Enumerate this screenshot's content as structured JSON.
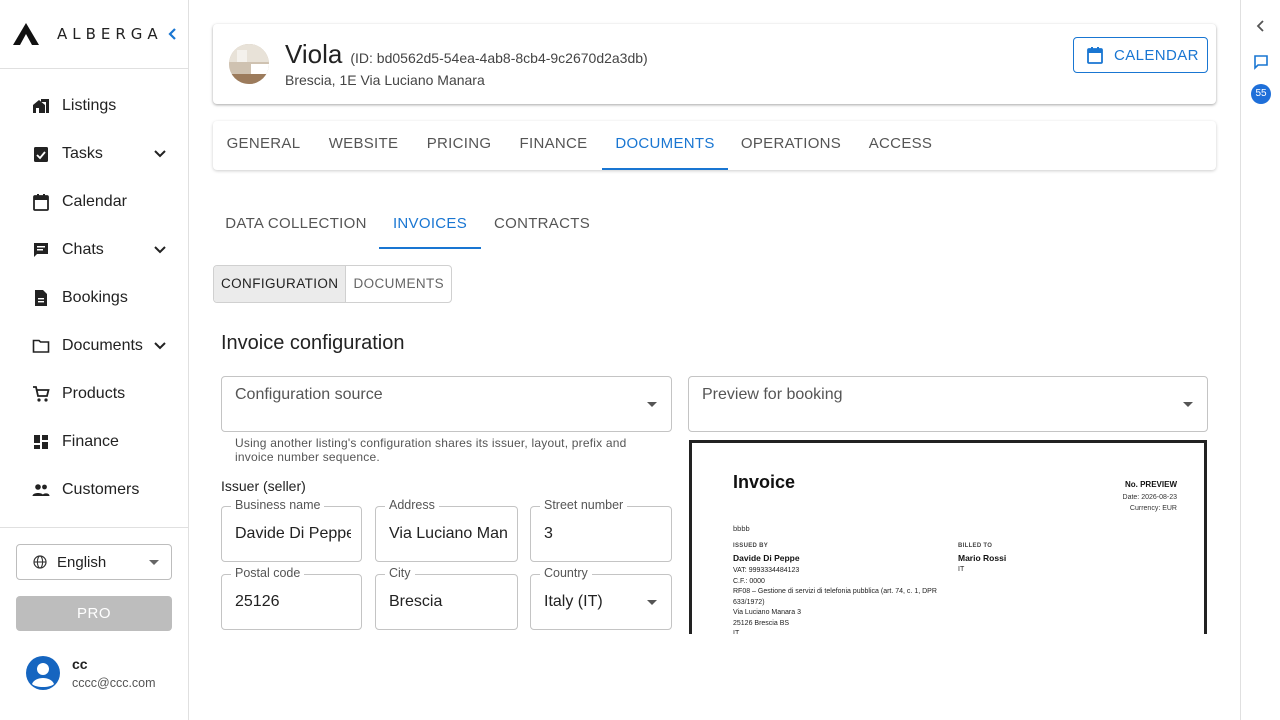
{
  "brand": {
    "name": "ALBERGA"
  },
  "nav": {
    "items": [
      {
        "label": "Listings",
        "icon": "home-work-icon",
        "expandable": false
      },
      {
        "label": "Tasks",
        "icon": "assignment-icon",
        "expandable": true
      },
      {
        "label": "Calendar",
        "icon": "calendar-icon",
        "expandable": false
      },
      {
        "label": "Chats",
        "icon": "chat-icon",
        "expandable": true
      },
      {
        "label": "Bookings",
        "icon": "document-icon",
        "expandable": false
      },
      {
        "label": "Documents",
        "icon": "folder-icon",
        "expandable": true
      },
      {
        "label": "Products",
        "icon": "cart-icon",
        "expandable": false
      },
      {
        "label": "Finance",
        "icon": "dashboard-icon",
        "expandable": false
      },
      {
        "label": "Customers",
        "icon": "people-icon",
        "expandable": false
      }
    ]
  },
  "language": {
    "selected": "English"
  },
  "pro_button": "PRO",
  "user": {
    "name": "cc",
    "email": "cccc@ccc.com"
  },
  "right_rail": {
    "badge_count": "55"
  },
  "listing": {
    "name": "Viola",
    "id_text": "(ID: bd0562d5-54ea-4ab8-8cb4-9c2670d2a3db)",
    "address": "Brescia, 1E Via Luciano Manara"
  },
  "calendar_button": "CALENDAR",
  "tabs": [
    {
      "label": "GENERAL",
      "active": false
    },
    {
      "label": "WEBSITE",
      "active": false
    },
    {
      "label": "PRICING",
      "active": false
    },
    {
      "label": "FINANCE",
      "active": false
    },
    {
      "label": "DOCUMENTS",
      "active": true
    },
    {
      "label": "OPERATIONS",
      "active": false
    },
    {
      "label": "ACCESS",
      "active": false
    }
  ],
  "subtabs": [
    {
      "label": "DATA COLLECTION",
      "active": false
    },
    {
      "label": "INVOICES",
      "active": true
    },
    {
      "label": "CONTRACTS",
      "active": false
    }
  ],
  "toggle": [
    {
      "label": "CONFIGURATION",
      "active": true
    },
    {
      "label": "DOCUMENTS",
      "active": false
    }
  ],
  "section_title": "Invoice configuration",
  "config_source": {
    "label": "Configuration source",
    "helper": "Using another listing's configuration shares its issuer, layout, prefix and invoice number sequence."
  },
  "preview_select": {
    "label": "Preview for booking"
  },
  "issuer_label": "Issuer (seller)",
  "fields": {
    "business_name": {
      "label": "Business name",
      "value": "Davide Di Peppe"
    },
    "address": {
      "label": "Address",
      "value": "Via Luciano Manara"
    },
    "street_number": {
      "label": "Street number",
      "value": "3"
    },
    "postal_code": {
      "label": "Postal code",
      "value": "25126"
    },
    "city": {
      "label": "City",
      "value": "Brescia"
    },
    "country": {
      "label": "Country",
      "value": "Italy (IT)"
    }
  },
  "invoice_preview": {
    "title": "Invoice",
    "number": "No. PREVIEW",
    "date": "Date: 2026-08-23",
    "currency": "Currency: EUR",
    "note": "bbbb",
    "issued_by_heading": "ISSUED BY",
    "issuer_name": "Davide Di Peppe",
    "issuer_lines": [
      "VAT: 9993334484123",
      "C.F.: 0000",
      "RF08 – Gestione di servizi di telefonia pubblica (art. 74, c. 1, DPR 633/1972)",
      "Via Luciano Manara 3",
      "25126 Brescia BS",
      "IT"
    ],
    "billed_to_heading": "BILLED TO",
    "billed_name": "Mario Rossi",
    "billed_country": "IT"
  }
}
